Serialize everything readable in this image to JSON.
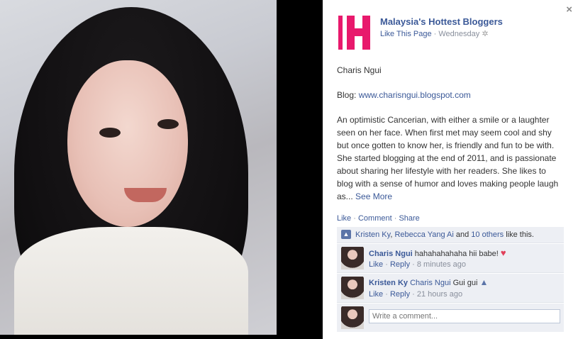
{
  "page": {
    "name": "Malaysia's Hottest Bloggers",
    "like_page": "Like This Page",
    "separator": " · ",
    "date": "Wednesday"
  },
  "post": {
    "name": "Charis Ngui",
    "blog_label": "Blog: ",
    "blog_url": "www.charisngui.blogspot.com",
    "description": "An optimistic Cancerian, with either a smile or a laughter seen on her face. When first met may seem cool and shy but once gotten to know her, is friendly and fun to be with. She started blogging at the end of 2011, and is passionate about sharing her lifestyle with her readers. She likes to blog with a sense of humor and loves making people laugh as...",
    "see_more": "See More"
  },
  "actions": {
    "like": "Like",
    "comment": "Comment",
    "share": "Share",
    "dot": " · "
  },
  "likes": {
    "person1": "Kristen Ky",
    "comma": ", ",
    "person2": "Rebecca Yang Ai",
    "and": " and ",
    "others": "10 others",
    "suffix": " like this."
  },
  "comments": [
    {
      "author": "Charis Ngui",
      "text": " hahahahahaha hii babe! ",
      "like": "Like",
      "reply": "Reply",
      "time": "8 minutes ago"
    },
    {
      "author": "Kristen Ky",
      "mention": "Charis Ngui",
      "text": " Gui gui ",
      "like": "Like",
      "reply": "Reply",
      "time": "21 hours ago"
    }
  ],
  "composer": {
    "placeholder": "Write a comment..."
  },
  "icons": {
    "close": "×",
    "gear": "✲",
    "thumb": "👍",
    "heart": "♥"
  },
  "colors": {
    "link": "#3b5998",
    "brand_pink": "#e8196c",
    "ufi_bg": "#edeff4"
  }
}
